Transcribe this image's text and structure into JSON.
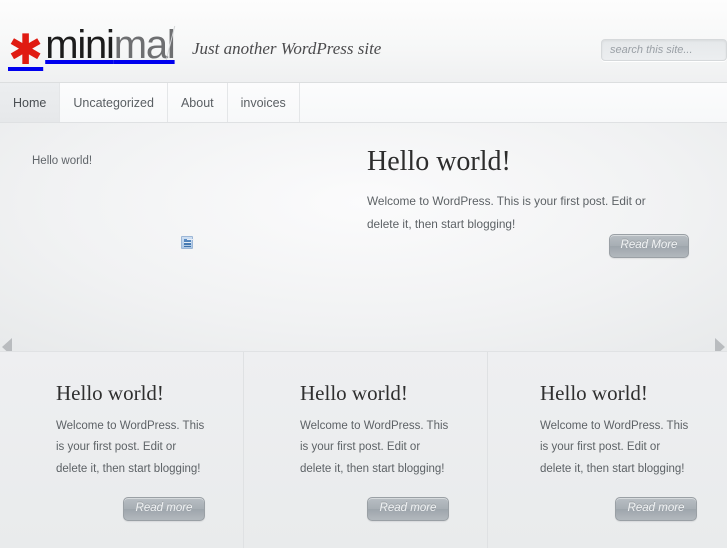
{
  "site": {
    "logo_prefix": "mini",
    "logo_suffix": "mal",
    "asterisk": "✳",
    "tagline": "Just another WordPress site"
  },
  "search": {
    "placeholder": "search this site...",
    "value": ""
  },
  "nav": {
    "items": [
      {
        "label": "Home",
        "active": true
      },
      {
        "label": "Uncategorized",
        "active": false
      },
      {
        "label": "About",
        "active": false
      },
      {
        "label": "invoices",
        "active": false
      }
    ]
  },
  "hero": {
    "image_alt": "Hello world!",
    "title": "Hello world!",
    "body": "Welcome to WordPress. This is your first post. Edit or delete it, then start blogging!",
    "button_label": "Read More",
    "prev_arrow": "prev-slide",
    "next_arrow": "next-slide"
  },
  "columns": [
    {
      "title": "Hello world!",
      "body": "Welcome to WordPress. This is your first post. Edit or delete it, then start blogging!",
      "button_label": "Read more"
    },
    {
      "title": "Hello world!",
      "body": "Welcome to WordPress. This is your first post. Edit or delete it, then start blogging!",
      "button_label": "Read more"
    },
    {
      "title": "Hello world!",
      "body": "Welcome to WordPress. This is your first post. Edit or delete it, then start blogging!",
      "button_label": "Read more"
    }
  ],
  "colors": {
    "accent_red": "#e01b12",
    "logo_dark": "#1c1c1c",
    "logo_light": "#6e6f71",
    "page_bg": "#e9ebec",
    "text": "#5d6266",
    "button_gray": "#a7aeb4"
  }
}
